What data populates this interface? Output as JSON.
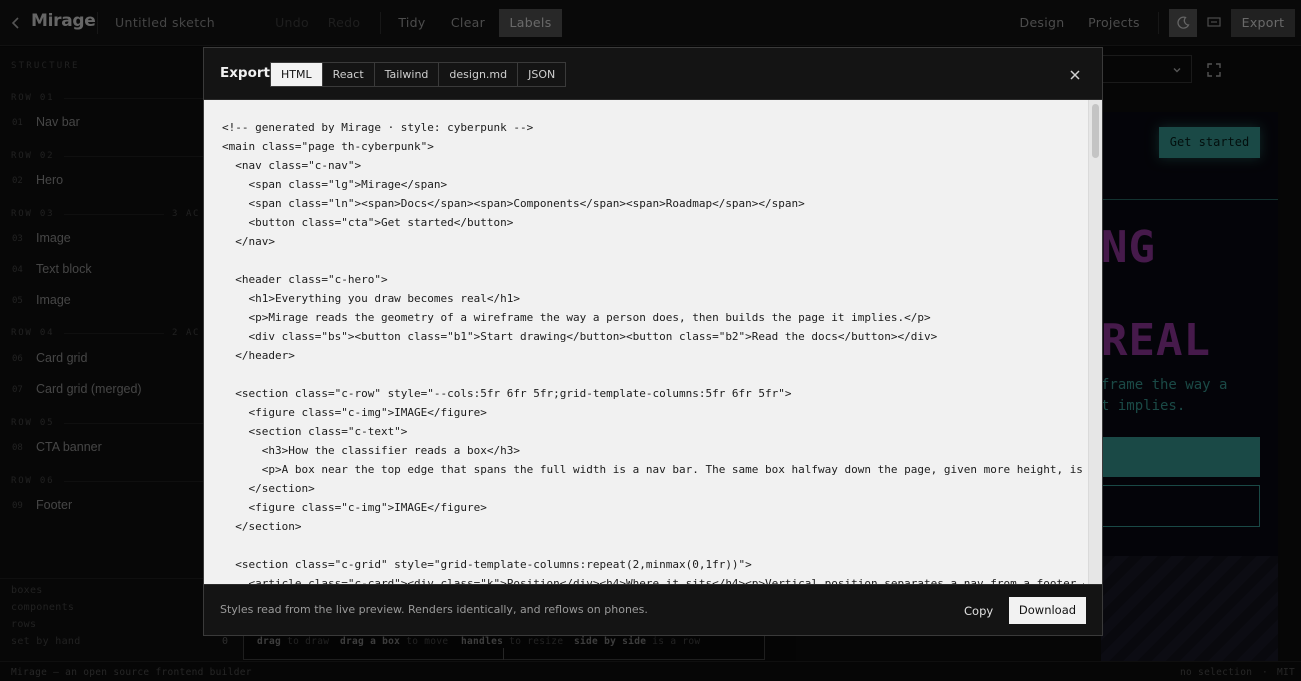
{
  "topbar": {
    "logo": "Mirage",
    "sketch_title": "Untitled sketch",
    "undo": "Undo",
    "redo": "Redo",
    "tidy": "Tidy",
    "clear": "Clear",
    "labels": "Labels",
    "design": "Design",
    "projects": "Projects",
    "export": "Export",
    "icons": {
      "back": "chevron-left-icon",
      "theme": "moon-icon",
      "preview": "monitor-icon"
    }
  },
  "sidebar": {
    "section_label": "STRUCTURE",
    "rows": [
      {
        "label": "ROW 01",
        "meta": "",
        "items": [
          {
            "num": "01",
            "name": "Nav bar"
          }
        ]
      },
      {
        "label": "ROW 02",
        "meta": "",
        "items": [
          {
            "num": "02",
            "name": "Hero"
          }
        ]
      },
      {
        "label": "ROW 03",
        "meta": "3 AC",
        "items": [
          {
            "num": "03",
            "name": "Image"
          },
          {
            "num": "04",
            "name": "Text block"
          },
          {
            "num": "05",
            "name": "Image"
          }
        ]
      },
      {
        "label": "ROW 04",
        "meta": "2 AC",
        "items": [
          {
            "num": "06",
            "name": "Card grid"
          },
          {
            "num": "07",
            "name": "Card grid (merged)"
          }
        ]
      },
      {
        "label": "ROW 05",
        "meta": "",
        "items": [
          {
            "num": "08",
            "name": "CTA banner"
          }
        ]
      },
      {
        "label": "ROW 06",
        "meta": "",
        "items": [
          {
            "num": "09",
            "name": "Footer"
          }
        ]
      }
    ],
    "legend": [
      "boxes",
      "components",
      "rows",
      "set by hand"
    ]
  },
  "canvas": {
    "counter": "0",
    "hints": [
      {
        "key": "drag",
        "desc": "to draw"
      },
      {
        "key": "drag a box",
        "desc": "to move"
      },
      {
        "key": "handles",
        "desc": "to resize"
      },
      {
        "key": "side by side",
        "desc": "is a row"
      }
    ]
  },
  "preview": {
    "cta": "Get started",
    "headline_1": "NG",
    "headline_2": "REAL",
    "sub_1": "frame the way a",
    "sub_2": "t implies."
  },
  "status": {
    "left": "Mirage — an open source frontend builder",
    "selection": "no selection",
    "sep": "·",
    "license": "MIT"
  },
  "modal": {
    "title": "Export",
    "tabs": [
      {
        "label": "HTML",
        "active": true
      },
      {
        "label": "React",
        "active": false
      },
      {
        "label": "Tailwind",
        "active": false
      },
      {
        "label": "design.md",
        "active": false
      },
      {
        "label": "JSON",
        "active": false
      }
    ],
    "close_icon": "close-icon",
    "code_lines": [
      "<!-- generated by Mirage · style: cyberpunk -->",
      "<main class=\"page th-cyberpunk\">",
      "  <nav class=\"c-nav\">",
      "    <span class=\"lg\">Mirage</span>",
      "    <span class=\"ln\"><span>Docs</span><span>Components</span><span>Roadmap</span></span>",
      "    <button class=\"cta\">Get started</button>",
      "  </nav>",
      "",
      "  <header class=\"c-hero\">",
      "    <h1>Everything you draw becomes real</h1>",
      "    <p>Mirage reads the geometry of a wireframe the way a person does, then builds the page it implies.</p>",
      "    <div class=\"bs\"><button class=\"b1\">Start drawing</button><button class=\"b2\">Read the docs</button></div>",
      "  </header>",
      "",
      "  <section class=\"c-row\" style=\"--cols:5fr 6fr 5fr;grid-template-columns:5fr 6fr 5fr\">",
      "    <figure class=\"c-img\">IMAGE</figure>",
      "    <section class=\"c-text\">",
      "      <h3>How the classifier reads a box</h3>",
      "      <p>A box near the top edge that spans the full width is a nav bar. The same box halfway down the page, given more height, is",
      "    </section>",
      "    <figure class=\"c-img\">IMAGE</figure>",
      "  </section>",
      "",
      "  <section class=\"c-grid\" style=\"grid-template-columns:repeat(2,minmax(0,1fr))\">",
      "    <article class=\"c-card\"><div class=\"k\">Position</div><h4>Where it sits</h4><p>Vertical position separates a nav from a footer.</p>"
    ],
    "foot_note": "Styles read from the live preview. Renders identically, and reflows on phones.",
    "copy": "Copy",
    "download": "Download"
  }
}
